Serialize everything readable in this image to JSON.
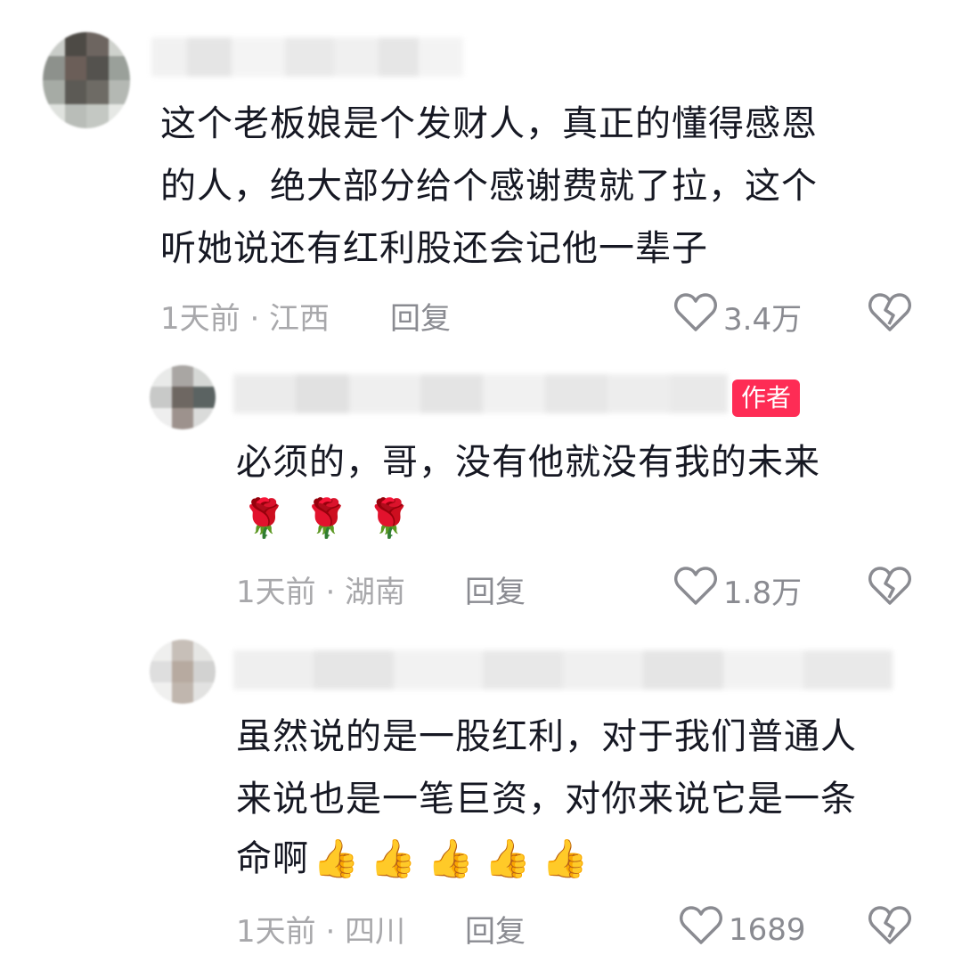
{
  "comments": [
    {
      "text_lines": [
        "这个老板娘是个发财人，真正的懂得感恩",
        "的人，绝大部分给个感谢费就了拉，这个",
        "听她说还有红利股还会记他一辈子"
      ],
      "time_location": "1天前 · 江西",
      "reply": "回复",
      "likes": "3.4万"
    },
    {
      "author_tag": "作者",
      "text_lines": [
        "必须的，哥，没有他就没有我的未来"
      ],
      "emojis": [
        "🌹",
        "🌹",
        "🌹"
      ],
      "time_location": "1天前 · 湖南",
      "reply": "回复",
      "likes": "1.8万"
    },
    {
      "text_lines": [
        "虽然说的是一股红利，对于我们普通人",
        "来说也是一笔巨资，对你来说它是一条"
      ],
      "last_line_prefix": "命啊",
      "emojis": [
        "👍",
        "👍",
        "👍",
        "👍",
        "👍"
      ],
      "time_location": "1天前 · 四川",
      "reply": "回复",
      "likes": "1689"
    }
  ],
  "icons": {
    "like": "heart-outline-icon",
    "dislike": "broken-heart-icon"
  },
  "colors": {
    "author_tag": "#fe2c55",
    "meta": "#a8a8ab"
  }
}
